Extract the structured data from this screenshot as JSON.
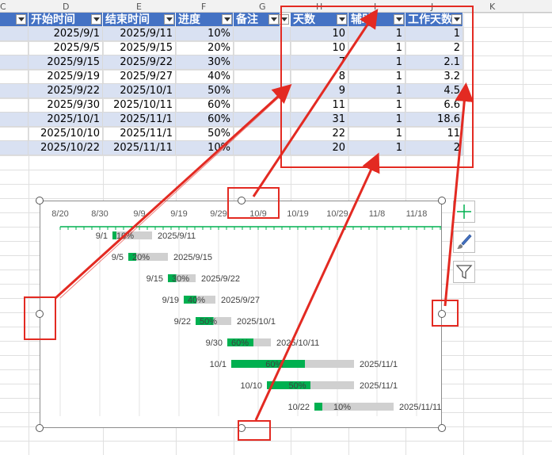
{
  "column_letters": [
    "C",
    "D",
    "E",
    "F",
    "G",
    "H",
    "I",
    "J",
    "K"
  ],
  "table": {
    "headers": [
      "开始时间",
      "结束时间",
      "进度",
      "备注",
      "天数",
      "辅助",
      "工作天数"
    ],
    "rows": [
      {
        "start": "2025/9/1",
        "end": "2025/9/11",
        "progress": "10%",
        "days": "10",
        "aux": "1",
        "workdays": "1"
      },
      {
        "start": "2025/9/5",
        "end": "2025/9/15",
        "progress": "20%",
        "days": "10",
        "aux": "1",
        "workdays": "2"
      },
      {
        "start": "2025/9/15",
        "end": "2025/9/22",
        "progress": "30%",
        "days": "7",
        "aux": "1",
        "workdays": "2.1"
      },
      {
        "start": "2025/9/19",
        "end": "2025/9/27",
        "progress": "40%",
        "days": "8",
        "aux": "1",
        "workdays": "3.2"
      },
      {
        "start": "2025/9/22",
        "end": "2025/10/1",
        "progress": "50%",
        "days": "9",
        "aux": "1",
        "workdays": "4.5"
      },
      {
        "start": "2025/9/30",
        "end": "2025/10/11",
        "progress": "60%",
        "days": "11",
        "aux": "1",
        "workdays": "6.6"
      },
      {
        "start": "2025/10/1",
        "end": "2025/11/1",
        "progress": "60%",
        "days": "31",
        "aux": "1",
        "workdays": "18.6"
      },
      {
        "start": "2025/10/10",
        "end": "2025/11/1",
        "progress": "50%",
        "days": "22",
        "aux": "1",
        "workdays": "11"
      },
      {
        "start": "2025/10/22",
        "end": "2025/11/11",
        "progress": "10%",
        "days": "20",
        "aux": "1",
        "workdays": "2"
      }
    ]
  },
  "chart_data": {
    "type": "bar",
    "x_axis_ticks": [
      "8/20",
      "8/30",
      "9/9",
      "9/19",
      "9/29",
      "10/9",
      "10/19",
      "10/29",
      "11/8",
      "11/18"
    ],
    "x_range": [
      "2025-08-20",
      "2025-11-25"
    ],
    "grid": true,
    "tasks": [
      {
        "start": "2025-09-01",
        "days": 10,
        "progress": 0.1,
        "start_label": "9/1",
        "progress_label": "10%",
        "end_label": "2025/9/11"
      },
      {
        "start": "2025-09-05",
        "days": 10,
        "progress": 0.2,
        "start_label": "9/5",
        "progress_label": "20%",
        "end_label": "2025/9/15"
      },
      {
        "start": "2025-09-15",
        "days": 7,
        "progress": 0.3,
        "start_label": "9/15",
        "progress_label": "30%",
        "end_label": "2025/9/22"
      },
      {
        "start": "2025-09-19",
        "days": 8,
        "progress": 0.4,
        "start_label": "9/19",
        "progress_label": "40%",
        "end_label": "2025/9/27"
      },
      {
        "start": "2025-09-22",
        "days": 9,
        "progress": 0.5,
        "start_label": "9/22",
        "progress_label": "50%",
        "end_label": "2025/10/1"
      },
      {
        "start": "2025-09-30",
        "days": 11,
        "progress": 0.6,
        "start_label": "9/30",
        "progress_label": "60%",
        "end_label": "2025/10/11"
      },
      {
        "start": "2025-10-01",
        "days": 31,
        "progress": 0.6,
        "start_label": "10/1",
        "progress_label": "60%",
        "end_label": "2025/11/1"
      },
      {
        "start": "2025-10-10",
        "days": 22,
        "progress": 0.5,
        "start_label": "10/10",
        "progress_label": "50%",
        "end_label": "2025/11/1"
      },
      {
        "start": "2025-10-22",
        "days": 20,
        "progress": 0.1,
        "start_label": "10/22",
        "progress_label": "10%",
        "end_label": "2025/11/11"
      }
    ],
    "colors": {
      "progress": "#00b050",
      "remaining": "#d0d0d0",
      "axis": "#00b050"
    }
  },
  "colors": {
    "header_bg": "#4472c4",
    "band": "#d9e1f2",
    "annotation": "#e32a22"
  },
  "icons": {
    "chart_elements": "plus-icon",
    "chart_styles": "brush-icon",
    "chart_filters": "funnel-icon"
  }
}
